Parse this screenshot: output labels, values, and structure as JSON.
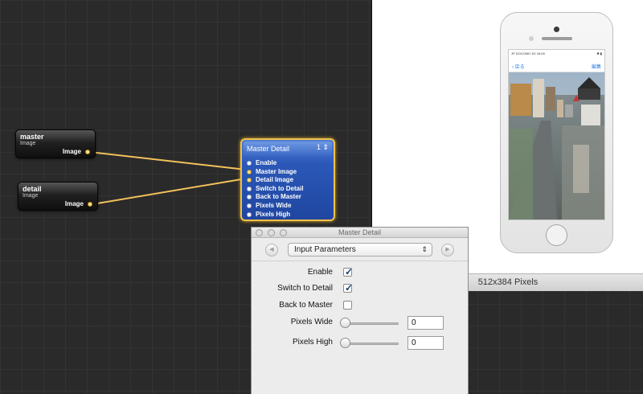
{
  "viewer": {
    "size_label": "512x384 Pixels",
    "iphone": {
      "status_carrier": "JP DOCOMO 3G 18:28",
      "status_right": "✱ ▮",
      "nav_back": "‹ 戻る",
      "nav_edit": "編集"
    }
  },
  "patches": {
    "master": {
      "title": "master",
      "subtitle": "Image",
      "port": "Image"
    },
    "detail": {
      "title": "detail",
      "subtitle": "Image",
      "port": "Image"
    },
    "master_detail": {
      "title": "Master Detail",
      "badge": "1 ⇕",
      "inputs": [
        "Enable",
        "Master Image",
        "Detail Image",
        "Switch to Detail",
        "Back to Master",
        "Pixels Wide",
        "Pixels High"
      ]
    }
  },
  "inspector": {
    "title": "Master Detail",
    "popup_value": "Input Parameters",
    "popup_arrows": "⇕",
    "params": {
      "enable": {
        "label": "Enable",
        "checked": true
      },
      "switch_to_detail": {
        "label": "Switch to Detail",
        "checked": true
      },
      "back_to_master": {
        "label": "Back to Master",
        "checked": false
      },
      "pixels_wide": {
        "label": "Pixels Wide",
        "value": "0"
      },
      "pixels_high": {
        "label": "Pixels High",
        "value": "0"
      }
    }
  },
  "colors": {
    "wire": "#f2c15a",
    "patch_blue": "#2b58b8",
    "selection_gold": "#f1c04a"
  },
  "icons": [
    "window-close-icon",
    "window-minimize-icon",
    "window-zoom-icon",
    "back-arrow-icon",
    "forward-arrow-icon",
    "checkmark-icon",
    "popup-arrows-icon",
    "camera-icon",
    "home-button-icon"
  ]
}
